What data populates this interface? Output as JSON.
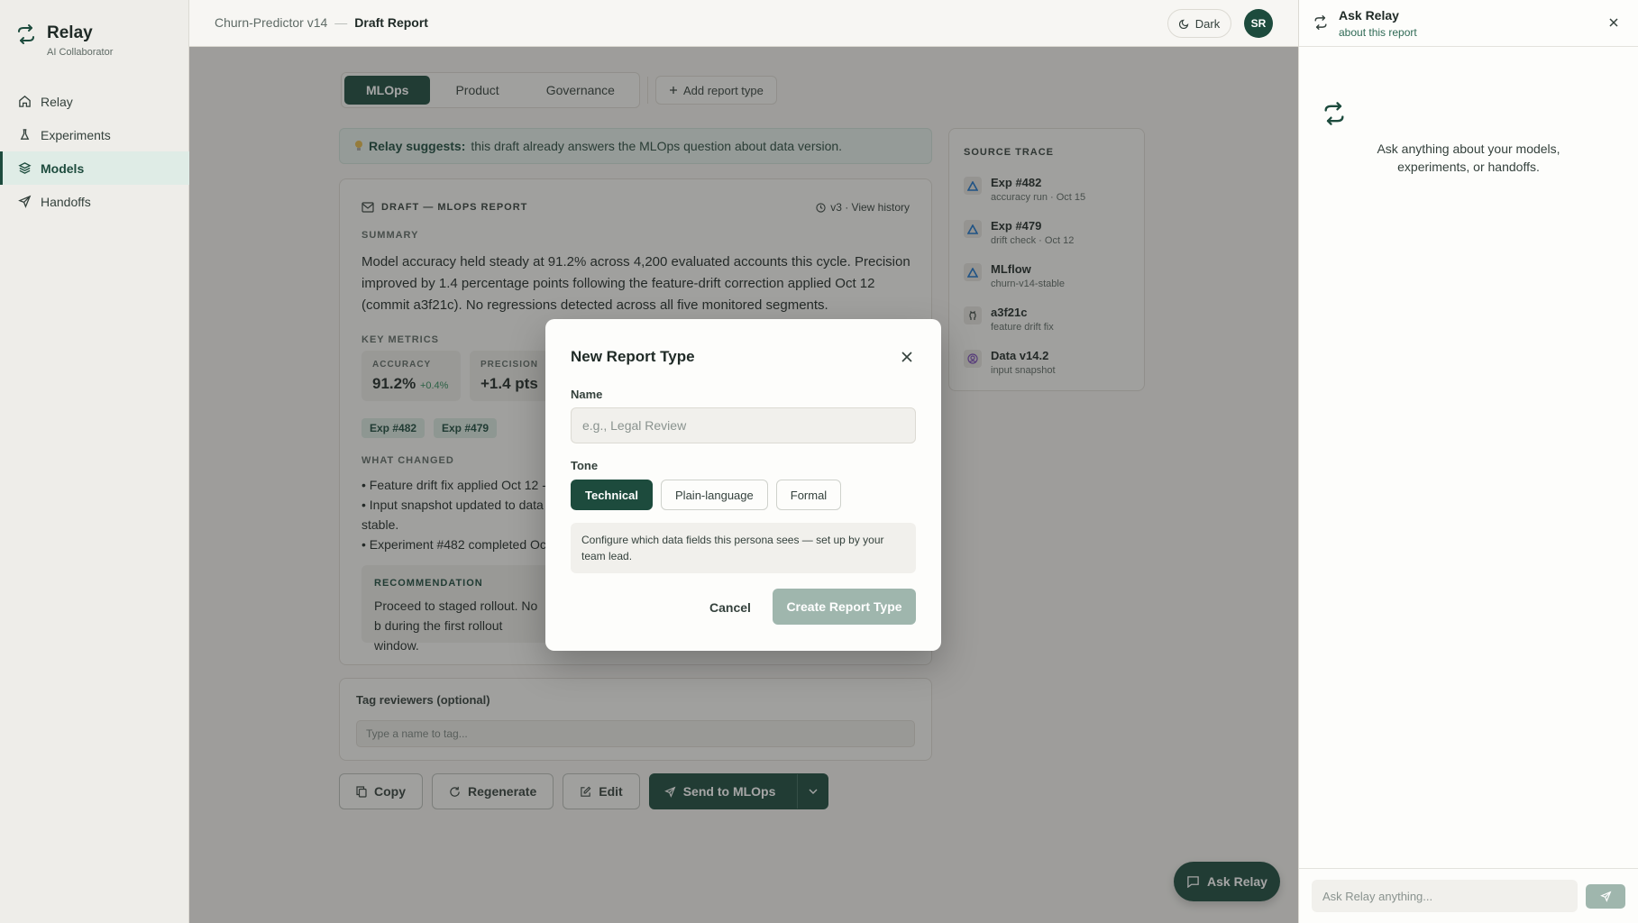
{
  "sidebar": {
    "brand": {
      "name": "Relay",
      "tagline": "AI Collaborator"
    },
    "items": [
      {
        "label": "Relay",
        "icon": "home-icon"
      },
      {
        "label": "Experiments",
        "icon": "flask-icon"
      },
      {
        "label": "Models",
        "icon": "layers-icon",
        "active": true
      },
      {
        "label": "Handoffs",
        "icon": "send-icon"
      }
    ]
  },
  "header": {
    "breadcrumb_parent": "Churn-Predictor v14",
    "breadcrumb_separator": "—",
    "breadcrumb_current": "Draft Report",
    "theme_toggle": "Dark",
    "avatar_initials": "SR"
  },
  "tabs": {
    "items": [
      "MLOps",
      "Product",
      "Governance"
    ],
    "active": "MLOps",
    "add_label": "Add report type"
  },
  "suggestion": {
    "lead": "Relay suggests:",
    "text": "this draft already answers the MLOps question about data version."
  },
  "report": {
    "title": "DRAFT — MLOPS REPORT",
    "version": "v3 · View history",
    "summary_label": "SUMMARY",
    "summary": "Model accuracy held steady at 91.2% across 4,200 evaluated accounts this cycle. Precision improved by 1.4 percentage points following the feature-drift correction applied Oct 12 (commit a3f21c). No regressions detected across all five monitored segments.",
    "metrics_label": "KEY METRICS",
    "metrics": [
      {
        "label": "ACCURACY",
        "value": "91.2%",
        "delta": "+0.4%"
      },
      {
        "label": "PRECISION",
        "value": "+1.4 pts",
        "delta": ""
      }
    ],
    "chips": [
      "Exp #482",
      "Exp #479"
    ],
    "changes_label": "WHAT CHANGED",
    "changes": [
      "• Feature drift fix applied Oct 12 -",
      "• Input snapshot updated to data",
      "stable.",
      "• Experiment #482 completed Oc"
    ],
    "recommendation_label": "RECOMMENDATION",
    "recommendation": "Proceed to staged rollout. No b during the first rollout window."
  },
  "tag_reviewers": {
    "label": "Tag reviewers (optional)",
    "placeholder": "Type a name to tag..."
  },
  "actions": {
    "copy": "Copy",
    "regenerate": "Regenerate",
    "edit": "Edit",
    "send": "Send to MLOps"
  },
  "source_trace": {
    "title": "SOURCE TRACE",
    "items": [
      {
        "name": "Exp #482",
        "detail": "accuracy run · Oct 15",
        "icon": "triangle-icon"
      },
      {
        "name": "Exp #479",
        "detail": "drift check · Oct 12",
        "icon": "triangle-icon"
      },
      {
        "name": "MLflow",
        "detail": "churn-v14-stable",
        "icon": "triangle-icon"
      },
      {
        "name": "a3f21c",
        "detail": "feature drift fix",
        "icon": "github-icon"
      },
      {
        "name": "Data v14.2",
        "detail": "input snapshot",
        "icon": "database-icon"
      }
    ]
  },
  "ask_fab": "Ask Relay",
  "modal": {
    "title": "New Report Type",
    "name_label": "Name",
    "name_placeholder": "e.g., Legal Review",
    "tone_label": "Tone",
    "tones": [
      "Technical",
      "Plain-language",
      "Formal"
    ],
    "tone_selected": "Technical",
    "note": "Configure which data fields this persona sees — set up by your team lead.",
    "cancel": "Cancel",
    "create": "Create Report Type"
  },
  "ask_panel": {
    "title": "Ask Relay",
    "subtitle": "about this report",
    "empty_text": "Ask anything about your models, experiments, or handoffs.",
    "input_placeholder": "Ask Relay anything..."
  },
  "colors": {
    "brand": "#1d4b3d",
    "accent_light": "#dfece6",
    "disabled": "#9fb6ad"
  }
}
